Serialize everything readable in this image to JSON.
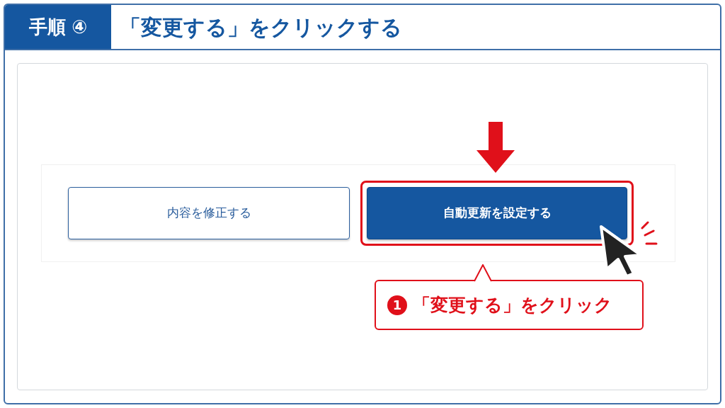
{
  "header": {
    "step_label": "手順",
    "step_number": "④",
    "title": "「変更する」をクリックする"
  },
  "buttons": [
    {
      "label": "内容を修正する",
      "kind": "outline",
      "highlighted": false
    },
    {
      "label": "自動更新を設定する",
      "kind": "primary",
      "highlighted": true
    }
  ],
  "callout": {
    "number": "1",
    "text": "「変更する」をクリック"
  }
}
